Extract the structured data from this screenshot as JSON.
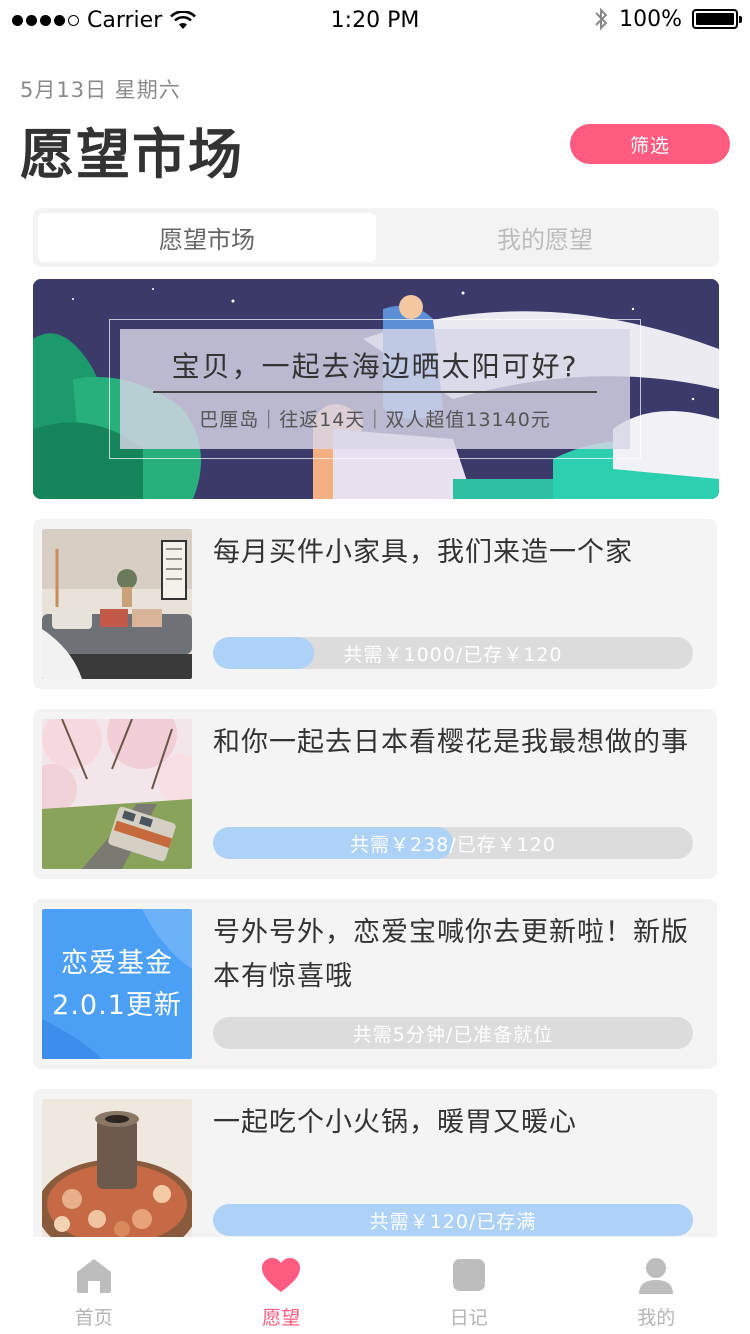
{
  "status_bar": {
    "carrier": "Carrier",
    "time": "1:20 PM",
    "battery": "100%"
  },
  "header": {
    "date": "5月13日 星期六",
    "title": "愿望市场",
    "filter_label": "筛选"
  },
  "tabs": [
    {
      "label": "愿望市场",
      "active": true
    },
    {
      "label": "我的愿望",
      "active": false
    }
  ],
  "banner": {
    "title": "宝贝，一起去海边晒太阳可好?",
    "subtitle": "巴厘岛｜往返14天｜双人超值13140元"
  },
  "wishes": [
    {
      "title": "每月买件小家具，我们来造一个家",
      "progress_text": "共需￥1000/已存￥120",
      "progress": 0.21,
      "image": "living-room-image"
    },
    {
      "title": "和你一起去日本看樱花是我最想做的事",
      "progress_text": "共需￥238/已存￥120",
      "progress": 0.5,
      "image": "cherry-blossom-train-image"
    },
    {
      "title": "号外号外，恋爱宝喊你去更新啦！新版本有惊喜哦",
      "progress_text": "共需5分钟/已准备就位",
      "progress": 0,
      "image": "update-promo-image",
      "image_text": [
        "恋爱基金",
        "2.0.1更新"
      ]
    },
    {
      "title": "一起吃个小火锅，暖胃又暖心",
      "progress_text": "共需￥120/已存满",
      "progress": 1.0,
      "image": "hotpot-image"
    }
  ],
  "tabbar": [
    {
      "label": "首页",
      "icon": "home-icon",
      "active": false
    },
    {
      "label": "愿望",
      "icon": "heart-icon",
      "active": true
    },
    {
      "label": "日记",
      "icon": "diary-icon",
      "active": false
    },
    {
      "label": "我的",
      "icon": "profile-icon",
      "active": false
    }
  ],
  "colors": {
    "accent": "#ff5a7f",
    "progress_fill": "#aed1f8",
    "progress_track": "#dcdcdc",
    "card_bg": "#f4f4f4"
  }
}
